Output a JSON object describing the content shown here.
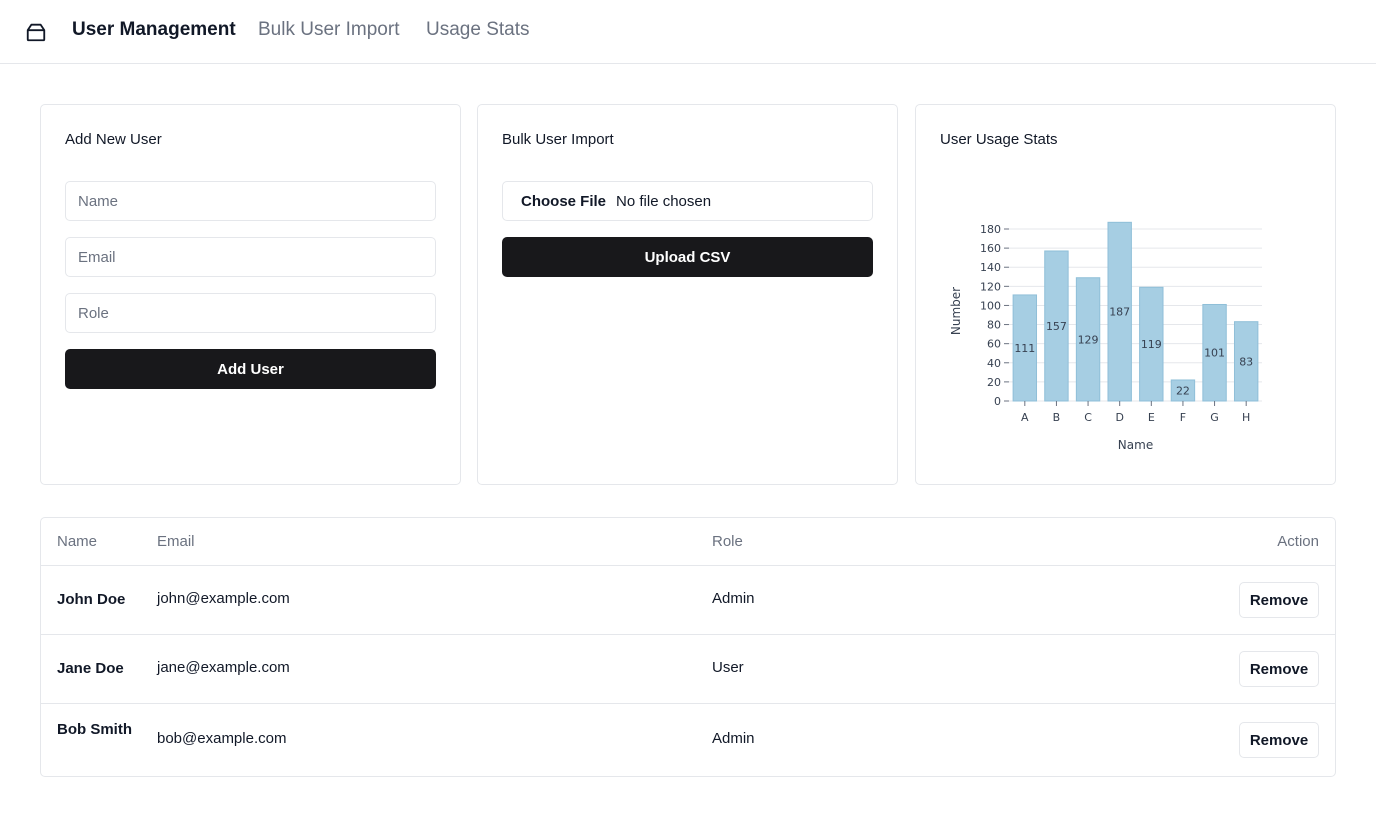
{
  "nav": {
    "logo_icon": "package-icon",
    "links": [
      "User Management",
      "Bulk User Import",
      "Usage Stats"
    ],
    "active_index": 0
  },
  "add_user": {
    "title": "Add New User",
    "name_placeholder": "Name",
    "email_placeholder": "Email",
    "role_placeholder": "Role",
    "submit_label": "Add User"
  },
  "bulk_import": {
    "title": "Bulk User Import",
    "choose_file_label": "Choose File",
    "file_status": "No file chosen",
    "upload_label": "Upload CSV"
  },
  "usage_stats": {
    "title": "User Usage Stats"
  },
  "chart_data": {
    "type": "bar",
    "categories": [
      "A",
      "B",
      "C",
      "D",
      "E",
      "F",
      "G",
      "H"
    ],
    "values": [
      111,
      157,
      129,
      187,
      119,
      22,
      101,
      83
    ],
    "xlabel": "Name",
    "ylabel": "Number",
    "ylim": [
      0,
      180
    ],
    "yticks": [
      0,
      20,
      40,
      60,
      80,
      100,
      120,
      140,
      160,
      180
    ],
    "grid": true,
    "bar_color": "#a6cee3",
    "data_labels": true
  },
  "table": {
    "columns": [
      "Name",
      "Email",
      "Role",
      "Action"
    ],
    "rows": [
      {
        "name": "John Doe",
        "email": "john@example.com",
        "role": "Admin",
        "action": "Remove"
      },
      {
        "name": "Jane Doe",
        "email": "jane@example.com",
        "role": "User",
        "action": "Remove"
      },
      {
        "name": "Bob Smith",
        "email": "bob@example.com",
        "role": "Admin",
        "action": "Remove"
      }
    ]
  }
}
